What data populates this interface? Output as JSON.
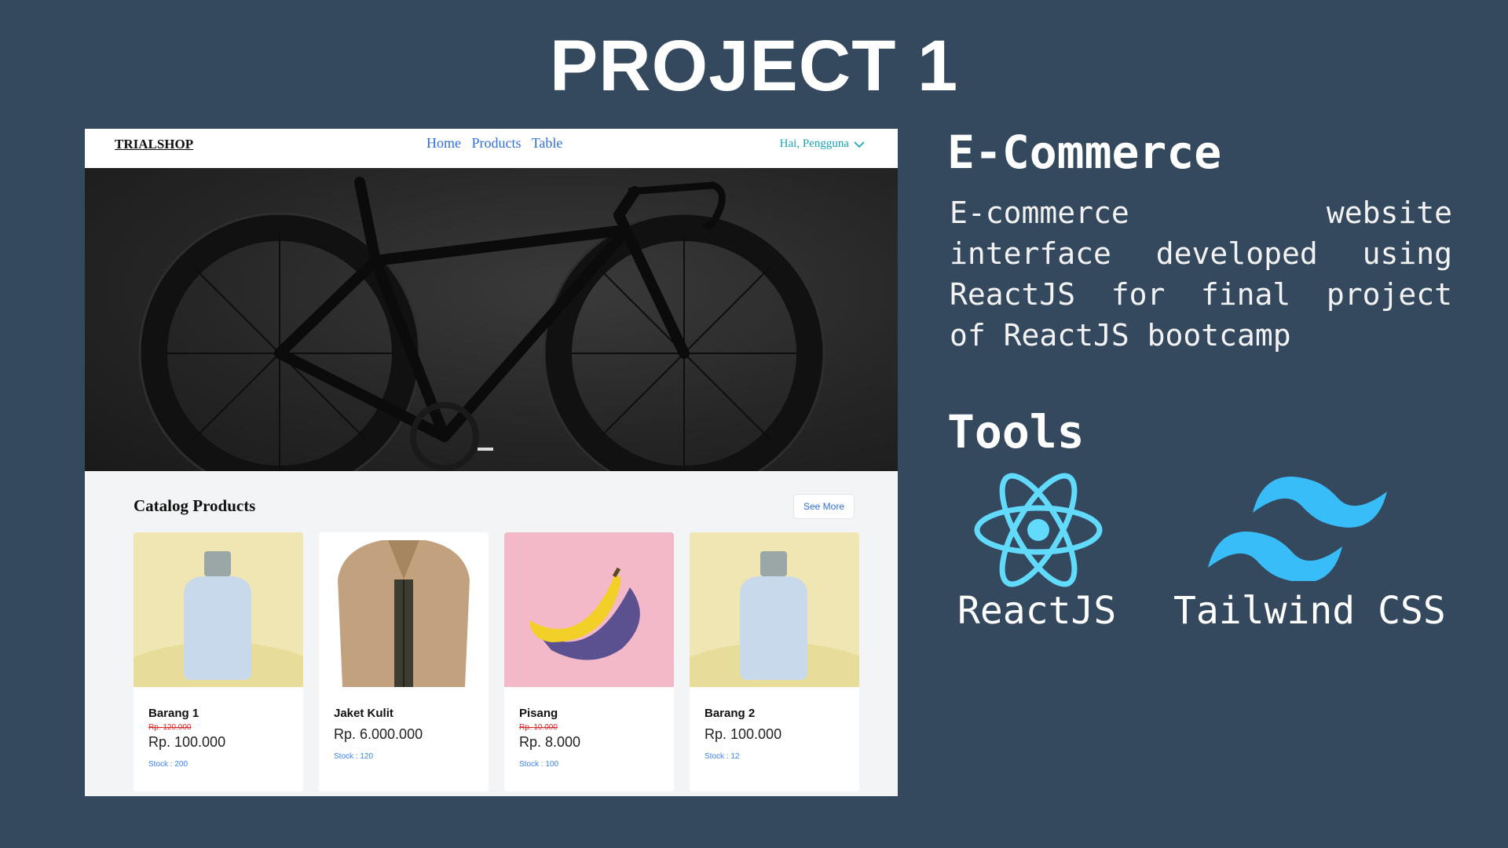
{
  "slide": {
    "title": "PROJECT 1",
    "project_name": "E-Commerce",
    "description": "E-commerce website interface developed using ReactJS for final project of ReactJS bootcamp",
    "tools_heading": "Tools",
    "tools": [
      {
        "label": "ReactJS",
        "icon": "react-logo-icon",
        "color": "#61dafb"
      },
      {
        "label": "Tailwind CSS",
        "icon": "tailwind-logo-icon",
        "color": "#38bdf8"
      }
    ]
  },
  "shop": {
    "brand": "TRIALSHOP",
    "nav": [
      "Home",
      "Products",
      "Table"
    ],
    "user_greeting": "Hai, Pengguna",
    "catalog_title": "Catalog Products",
    "see_more": "See More",
    "products": [
      {
        "name": "Barang 1",
        "old_price": "Rp. 120.000",
        "price": "Rp. 100.000",
        "stock": "Stock : 200",
        "image": "bottle"
      },
      {
        "name": "Jaket Kulit",
        "old_price": "",
        "price": "Rp. 6.000.000",
        "stock": "Stock : 120",
        "image": "jacket"
      },
      {
        "name": "Pisang",
        "old_price": "Rp. 10.000",
        "price": "Rp. 8.000",
        "stock": "Stock : 100",
        "image": "banana"
      },
      {
        "name": "Barang 2",
        "old_price": "",
        "price": "Rp. 100.000",
        "stock": "Stock : 12",
        "image": "bottle"
      }
    ]
  },
  "colors": {
    "background": "#34495e",
    "link": "#2f6fe0",
    "greeting": "#17a2b8",
    "discount": "#e02424",
    "stock": "#3b82f6"
  }
}
